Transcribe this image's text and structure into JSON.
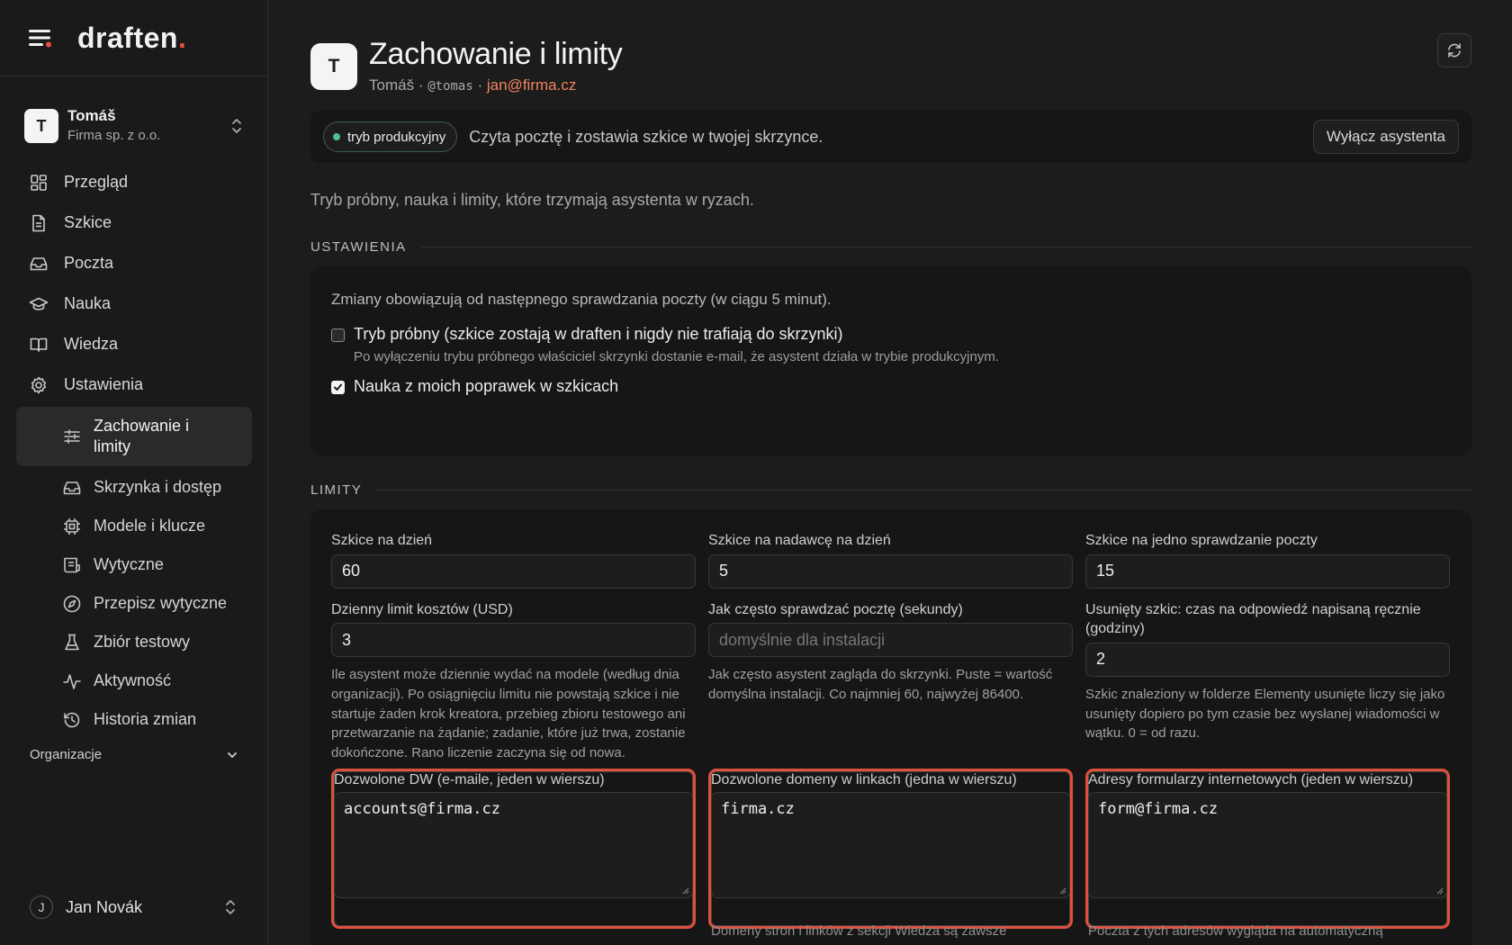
{
  "brand": {
    "logo_text": "draften",
    "logo_dot": "."
  },
  "account": {
    "initial": "T",
    "name": "Tomáš",
    "org": "Firma sp. z o.o."
  },
  "nav": {
    "items": [
      {
        "label": "Przegląd",
        "icon": "grid-icon"
      },
      {
        "label": "Szkice",
        "icon": "document-icon"
      },
      {
        "label": "Poczta",
        "icon": "inbox-icon"
      },
      {
        "label": "Nauka",
        "icon": "graduation-cap-icon"
      },
      {
        "label": "Wiedza",
        "icon": "book-icon"
      },
      {
        "label": "Ustawienia",
        "icon": "gear-icon"
      }
    ],
    "sub_items": [
      {
        "label": "Zachowanie i limity",
        "icon": "sliders-icon",
        "active": true
      },
      {
        "label": "Skrzynka i dostęp",
        "icon": "inbox-icon"
      },
      {
        "label": "Modele i klucze",
        "icon": "chip-icon"
      },
      {
        "label": "Wytyczne",
        "icon": "list-icon"
      },
      {
        "label": "Przepisz wytyczne",
        "icon": "compass-icon"
      },
      {
        "label": "Zbiór testowy",
        "icon": "flask-icon"
      },
      {
        "label": "Aktywność",
        "icon": "activity-icon"
      },
      {
        "label": "Historia zmian",
        "icon": "history-icon"
      }
    ],
    "orgs_label": "Organizacje"
  },
  "user": {
    "initial": "J",
    "name": "Jan Novák"
  },
  "header": {
    "initial": "T",
    "title": "Zachowanie i limity",
    "name": "Tomáš",
    "separator": " · ",
    "handle": "@tomas",
    "email": "jan@firma.cz"
  },
  "mode": {
    "badge": "tryb produkcyjny",
    "text": "Czyta pocztę i zostawia szkice w twojej skrzynce.",
    "button": "Wyłącz asystenta"
  },
  "intro": "Tryb próbny, nauka i limity, które trzymają asystenta w ryzach.",
  "settings": {
    "title": "USTAWIENIA",
    "notice": "Zmiany obowiązują od następnego sprawdzania poczty (w ciągu 5 minut).",
    "trial": {
      "label": "Tryb próbny (szkice zostają w draften i nigdy nie trafiają do skrzynki)",
      "help": "Po wyłączeniu trybu próbnego właściciel skrzynki dostanie e-mail, że asystent działa w trybie produkcyjnym.",
      "checked": false
    },
    "learn": {
      "label": "Nauka z moich poprawek w szkicach",
      "checked": true
    }
  },
  "limits": {
    "title": "LIMITY",
    "drafts_per_day": {
      "label": "Szkice na dzień",
      "value": "60"
    },
    "drafts_per_sender": {
      "label": "Szkice na nadawcę na dzień",
      "value": "5"
    },
    "drafts_per_check": {
      "label": "Szkice na jedno sprawdzanie poczty",
      "value": "15"
    },
    "cost_limit": {
      "label": "Dzienny limit kosztów (USD)",
      "value": "3",
      "help": "Ile asystent może dziennie wydać na modele (według dnia organizacji). Po osiągnięciu limitu nie powstają szkice i nie startuje żaden krok kreatora, przebieg zbioru testowego ani przetwarzanie na żądanie; zadanie, które już trwa, zostanie dokończone. Rano liczenie zaczyna się od nowa."
    },
    "poll_interval": {
      "label": "Jak często sprawdzać pocztę (sekundy)",
      "placeholder": "domyślnie dla instalacji",
      "help": "Jak często asystent zagląda do skrzynki. Puste = wartość domyślna instalacji. Co najmniej 60, najwyżej 86400."
    },
    "deleted_draft": {
      "label": "Usunięty szkic: czas na odpowiedź napisaną ręcznie (godziny)",
      "value": "2",
      "help": "Szkic znaleziony w folderze Elementy usunięte liczy się jako usunięty dopiero po tym czasie bez wysłanej wiadomości w wątku. 0 = od razu."
    },
    "allowed_bcc": {
      "label": "Dozwolone DW (e-maile, jeden w wierszu)",
      "value": "accounts@firma.cz"
    },
    "allowed_domains": {
      "label": "Dozwolone domeny w linkach (jedna w wierszu)",
      "value": "firma.cz",
      "help": "Domeny stron i linków z sekcji Wiedza są zawsze"
    },
    "web_forms": {
      "label": "Adresy formularzy internetowych (jeden w wierszu)",
      "value": "form@firma.cz",
      "help": "Poczta z tych adresów wygląda na automatyczną"
    }
  },
  "colors": {
    "accent": "#e5533c",
    "email": "#f0845f",
    "status_green": "#4ec28a",
    "highlight": "#e0503c"
  }
}
